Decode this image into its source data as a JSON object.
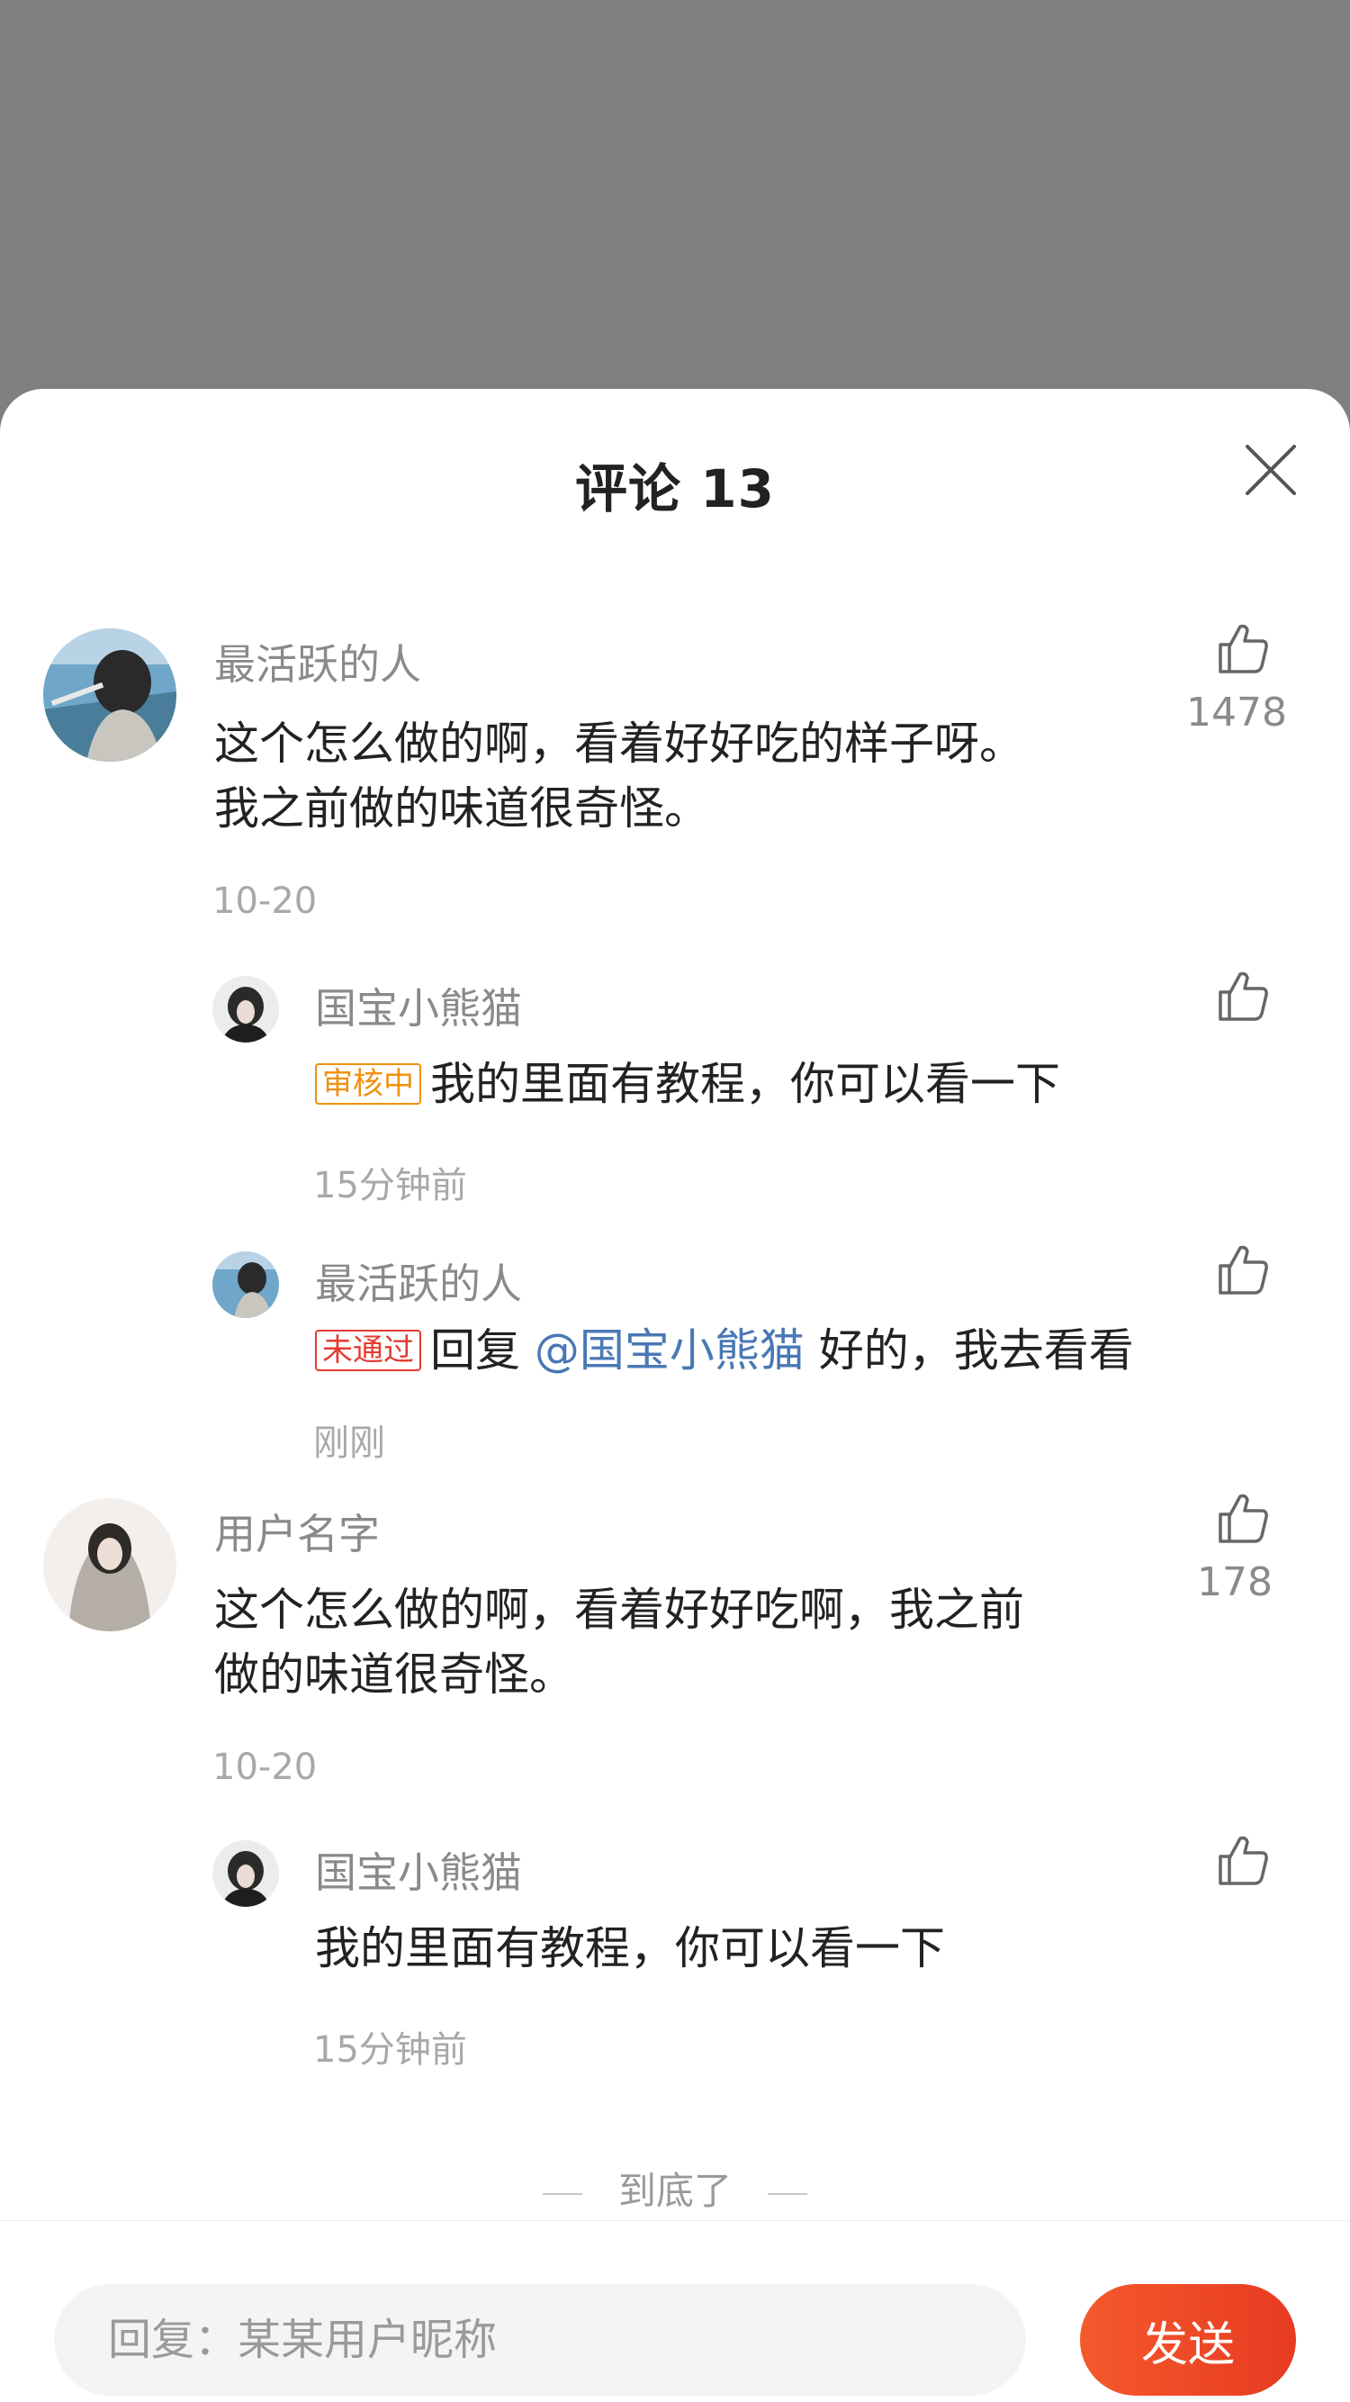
{
  "sheet": {
    "title": "评论 13",
    "close_icon": "close-icon"
  },
  "comments": [
    {
      "username": "最活跃的人",
      "content_line1": "这个怎么做的啊，看着好好吃的样子呀。",
      "content_line2": "我之前做的味道很奇怪。",
      "time": "10-20",
      "likes": "1478",
      "replies": [
        {
          "username": "国宝小熊猫",
          "tag": "审核中",
          "content": "我的里面有教程，你可以看一下",
          "time": "15分钟前"
        },
        {
          "username": "最活跃的人",
          "tag": "未通过",
          "reply_prefix": "回复",
          "mention": "@国宝小熊猫",
          "content": "好的，我去看看",
          "time": "刚刚"
        }
      ]
    },
    {
      "username": "用户名字",
      "content_line1": "这个怎么做的啊，看着好好吃啊，我之前",
      "content_line2": "做的味道很奇怪。",
      "time": "10-20",
      "likes": "178",
      "replies": [
        {
          "username": "国宝小熊猫",
          "content": "我的里面有教程，你可以看一下",
          "time": "15分钟前"
        }
      ]
    }
  ],
  "end_text": "到底了",
  "input": {
    "placeholder": "回复：某某用户昵称",
    "send_label": "发送"
  },
  "colors": {
    "accent": "#e73b22",
    "mention": "#4a78b5",
    "tag_review": "#f0900e",
    "tag_reject": "#e53a30"
  }
}
